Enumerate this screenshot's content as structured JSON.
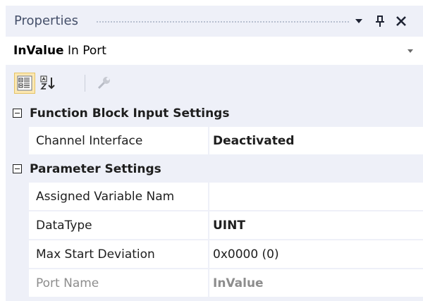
{
  "window": {
    "title": "Properties",
    "dropdown_icon": "chevron-down-icon",
    "pin_icon": "pin-icon",
    "close_icon": "close-icon"
  },
  "object_selector": {
    "name": "InValue",
    "type": "In Port"
  },
  "toolbar": {
    "buttons": [
      {
        "icon": "categorized-icon",
        "active": true
      },
      {
        "icon": "alphabetical-icon",
        "active": false
      },
      {
        "icon": "property-pages-icon",
        "active": false
      }
    ]
  },
  "grid": {
    "categories": [
      {
        "label": "Function Block Input Settings",
        "expanded": true,
        "rows": [
          {
            "name": "Channel Interface",
            "value": "Deactivated",
            "bold": true
          }
        ]
      },
      {
        "label": "Parameter Settings",
        "expanded": true,
        "rows": [
          {
            "name": "Assigned Variable Nam",
            "value": "",
            "bold": false
          },
          {
            "name": "DataType",
            "value": "UINT",
            "bold": true
          },
          {
            "name": "Max Start Deviation",
            "value": "0x0000 (0)",
            "bold": false
          },
          {
            "name": "Port Name",
            "value": "InValue",
            "bold": true,
            "disabled": true
          }
        ]
      }
    ]
  },
  "colors": {
    "panel_bg": "#eef0f8",
    "row_bg": "#ffffff",
    "text": "#1e1e1e",
    "disabled_text": "#8d8d8d",
    "active_button_bg": "#fce8b2"
  }
}
